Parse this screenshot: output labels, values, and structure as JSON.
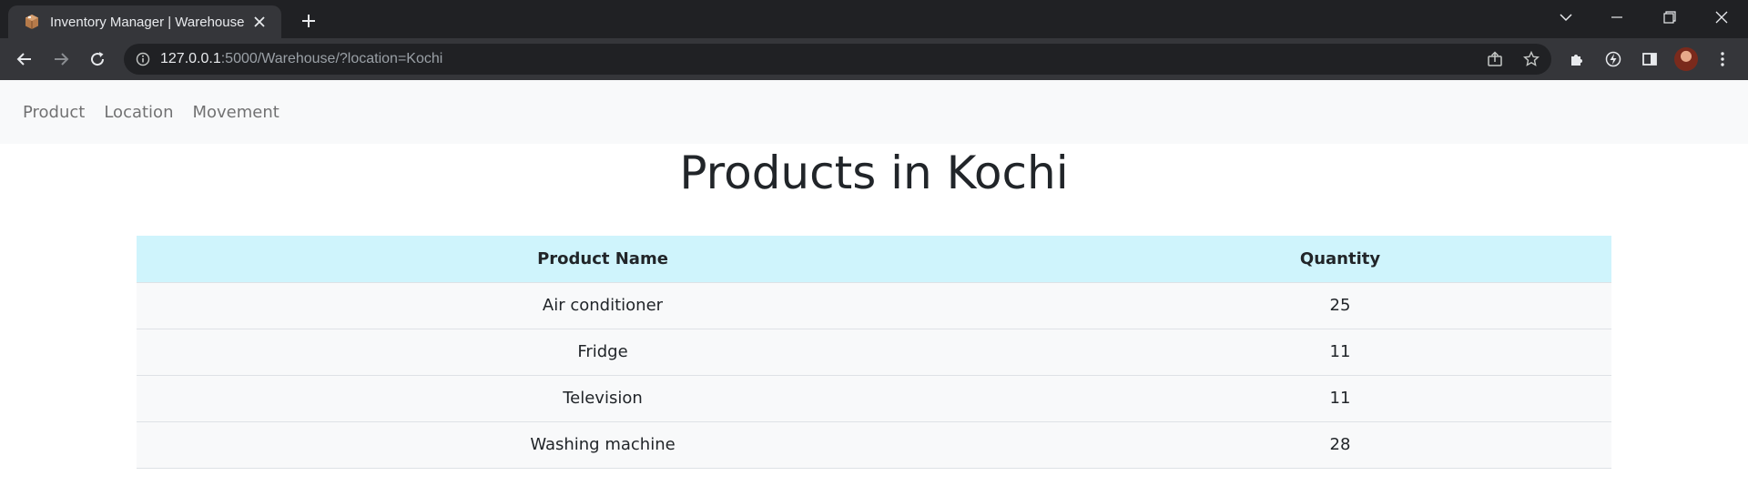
{
  "browser": {
    "tab_title": "Inventory Manager | Warehouse",
    "url_host": "127.0.0.1",
    "url_rest": ":5000/Warehouse/?location=Kochi",
    "icons": [
      "box-favicon-icon",
      "close-icon",
      "plus-icon",
      "chevron-down-icon",
      "minimize-icon",
      "restore-icon",
      "close-window-icon",
      "back-arrow-icon",
      "forward-arrow-icon",
      "reload-icon",
      "info-icon",
      "share-icon",
      "star-icon",
      "puzzle-icon",
      "lightning-icon",
      "sidebar-icon",
      "menu-dots-icon"
    ]
  },
  "nav": {
    "items": [
      {
        "label": "Product"
      },
      {
        "label": "Location"
      },
      {
        "label": "Movement"
      }
    ]
  },
  "main": {
    "title": "Products in Kochi",
    "table": {
      "headers": [
        "Product Name",
        "Quantity"
      ],
      "rows": [
        [
          "Air conditioner",
          "25"
        ],
        [
          "Fridge",
          "11"
        ],
        [
          "Television",
          "11"
        ],
        [
          "Washing machine",
          "28"
        ]
      ]
    }
  },
  "colors": {
    "header_bg": "#cff4fc",
    "row_bg": "#f8f9fa",
    "navbar_bg": "#f8f9fa",
    "chrome_dark": "#202124",
    "chrome_toolbar": "#35363a"
  }
}
